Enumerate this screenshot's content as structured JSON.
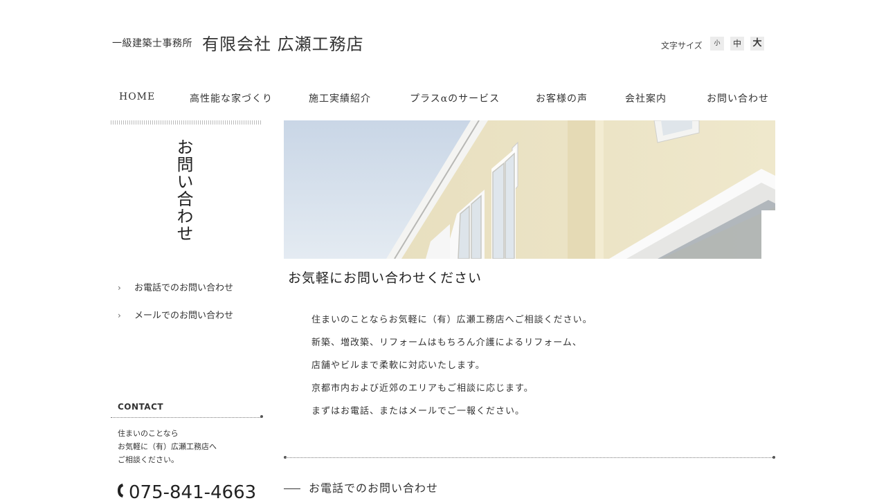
{
  "header": {
    "brand_sub": "一級建築士事務所",
    "brand_main": "有限会社 広瀬工務店",
    "font_size_label": "文字サイズ",
    "font_sizes": [
      "小",
      "中",
      "大"
    ]
  },
  "nav": {
    "items": [
      "HOME",
      "高性能な家づくり",
      "施工実績紹介",
      "プラスαのサービス",
      "お客様の声",
      "会社案内",
      "お問い合わせ"
    ]
  },
  "sidebar": {
    "title": "お問い合わせ",
    "links": [
      "お電話でのお問い合わせ",
      "メールでのお問い合わせ"
    ],
    "contact": {
      "heading": "CONTACT",
      "lines": [
        "住まいのことなら",
        "お気軽に（有）広瀬工務店へ",
        "ご相談ください。"
      ],
      "phone": "075-841-4663"
    }
  },
  "main": {
    "heading": "お気軽にお問い合わせください",
    "intro": [
      "住まいのことならお気軽に（有）広瀬工務店へご相談ください。",
      "新築、増改築、リフォームはもちろん介護によるリフォーム、",
      "店舗やビルまで柔軟に対応いたします。",
      "京都市内および近郊のエリアもご相談に応じます。",
      "まずはお電話、またはメールでご一報ください。"
    ],
    "phone_section_title": "お電話でのお問い合わせ"
  },
  "icons": {
    "chevron": "chevron-right-icon",
    "phone": "phone-icon"
  }
}
